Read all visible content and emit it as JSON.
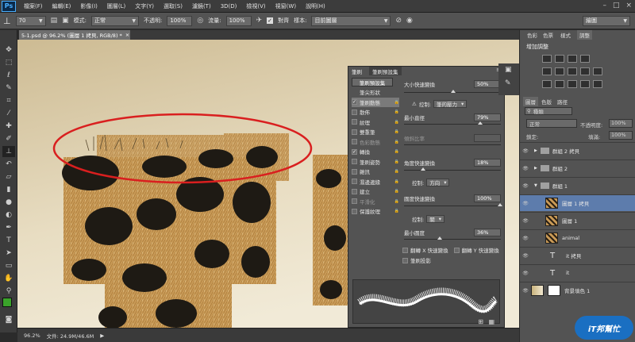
{
  "app": {
    "logo": "Ps"
  },
  "menu": [
    "檔案(F)",
    "編輯(E)",
    "影像(I)",
    "圖層(L)",
    "文字(Y)",
    "選取(S)",
    "濾鏡(T)",
    "3D(D)",
    "檢視(V)",
    "視窗(W)",
    "說明(H)"
  ],
  "window_controls": [
    "–",
    "□",
    "×"
  ],
  "options": {
    "brush_size": "70",
    "mode_label": "模式:",
    "mode_value": "正常",
    "opacity_label": "不透明:",
    "opacity_value": "100%",
    "flow_label": "流量:",
    "flow_value": "100%",
    "smooth_label": "對齊",
    "sample_label": "樣本:",
    "sample_value": "目前圖層",
    "workspace_value": "繪圖"
  },
  "document_tab": "5-1.psd @ 96.2% (圖層 1 拷貝, RGB/8) *",
  "status": {
    "zoom": "96.2%",
    "doc_size": "文件: 24.9M/46.6M"
  },
  "brush_panel": {
    "tabs": [
      "筆刷",
      "筆刷預設集"
    ],
    "preset_button": "筆刷預設集",
    "options": [
      {
        "label": "筆尖形狀",
        "checked": false,
        "dim": false,
        "heading": true
      },
      {
        "label": "筆刷動態",
        "checked": true,
        "dim": false,
        "selected": true
      },
      {
        "label": "散佈",
        "checked": false,
        "dim": false
      },
      {
        "label": "紋理",
        "checked": false,
        "dim": false
      },
      {
        "label": "雙重筆",
        "checked": false,
        "dim": false
      },
      {
        "label": "色彩動態",
        "checked": false,
        "dim": true
      },
      {
        "label": "轉換",
        "checked": true,
        "dim": false
      },
      {
        "label": "筆刷姿勢",
        "checked": false,
        "dim": false
      },
      {
        "label": "雜訊",
        "checked": false,
        "dim": false
      },
      {
        "label": "濕邊邊緣",
        "checked": false,
        "dim": false
      },
      {
        "label": "建立",
        "checked": false,
        "dim": false
      },
      {
        "label": "平滑化",
        "checked": false,
        "dim": true
      },
      {
        "label": "保護紋理",
        "checked": false,
        "dim": false
      }
    ],
    "size_jitter_label": "大小快速變換",
    "size_jitter_value": "50%",
    "size_jitter_pct": 0.5,
    "control_label": "控制:",
    "control_value1": "筆的壓力",
    "min_diameter_label": "最小直徑",
    "min_diameter_value": "79%",
    "min_diameter_pct": 0.79,
    "tilt_scale_label": "傾斜比率",
    "angle_jitter_label": "角度快速變換",
    "angle_jitter_value": "18%",
    "angle_jitter_pct": 0.18,
    "control_value2": "方向",
    "roundness_jitter_label": "圓度快速變換",
    "roundness_jitter_value": "100%",
    "roundness_jitter_pct": 1.0,
    "control_value3": "關",
    "min_roundness_label": "最小圓度",
    "min_roundness_value": "36%",
    "min_roundness_pct": 0.36,
    "flip_x_label": "翻轉 X 快速變換",
    "flip_y_label": "翻轉 Y 快速變換",
    "projection_label": "筆刷投影"
  },
  "right_panel": {
    "top_tabs": [
      "色彩",
      "色票",
      "樣式",
      "調整"
    ],
    "adjust_title": "增加調整",
    "layer_tabs": [
      "圖層",
      "色版",
      "路徑"
    ],
    "kind_value": "種類",
    "blend_value": "正常",
    "opacity_label": "不透明度:",
    "opacity_value": "100%",
    "lock_label": "鎖定:",
    "fill_label": "填滿:",
    "fill_value": "100%",
    "layers": [
      {
        "name": "群組 2 拷貝",
        "kind": "folder",
        "selected": false
      },
      {
        "name": "群組 2",
        "kind": "folder",
        "selected": false
      },
      {
        "name": "群組 1",
        "kind": "folder-open",
        "selected": false
      },
      {
        "name": "圖層 1 拷貝",
        "kind": "image",
        "selected": true
      },
      {
        "name": "圖層 1",
        "kind": "image",
        "selected": false
      },
      {
        "name": "animal",
        "kind": "image",
        "selected": false
      },
      {
        "name": "it 拷貝",
        "kind": "text",
        "selected": false
      },
      {
        "name": "it",
        "kind": "text",
        "selected": false
      },
      {
        "name": "背景填色 1",
        "kind": "fill",
        "selected": false
      }
    ]
  },
  "watermark": "iT邦幫忙",
  "colors": {
    "fg": "#3aa32a",
    "bg": "#ffffff",
    "selection_ring": "#d91f1f"
  }
}
